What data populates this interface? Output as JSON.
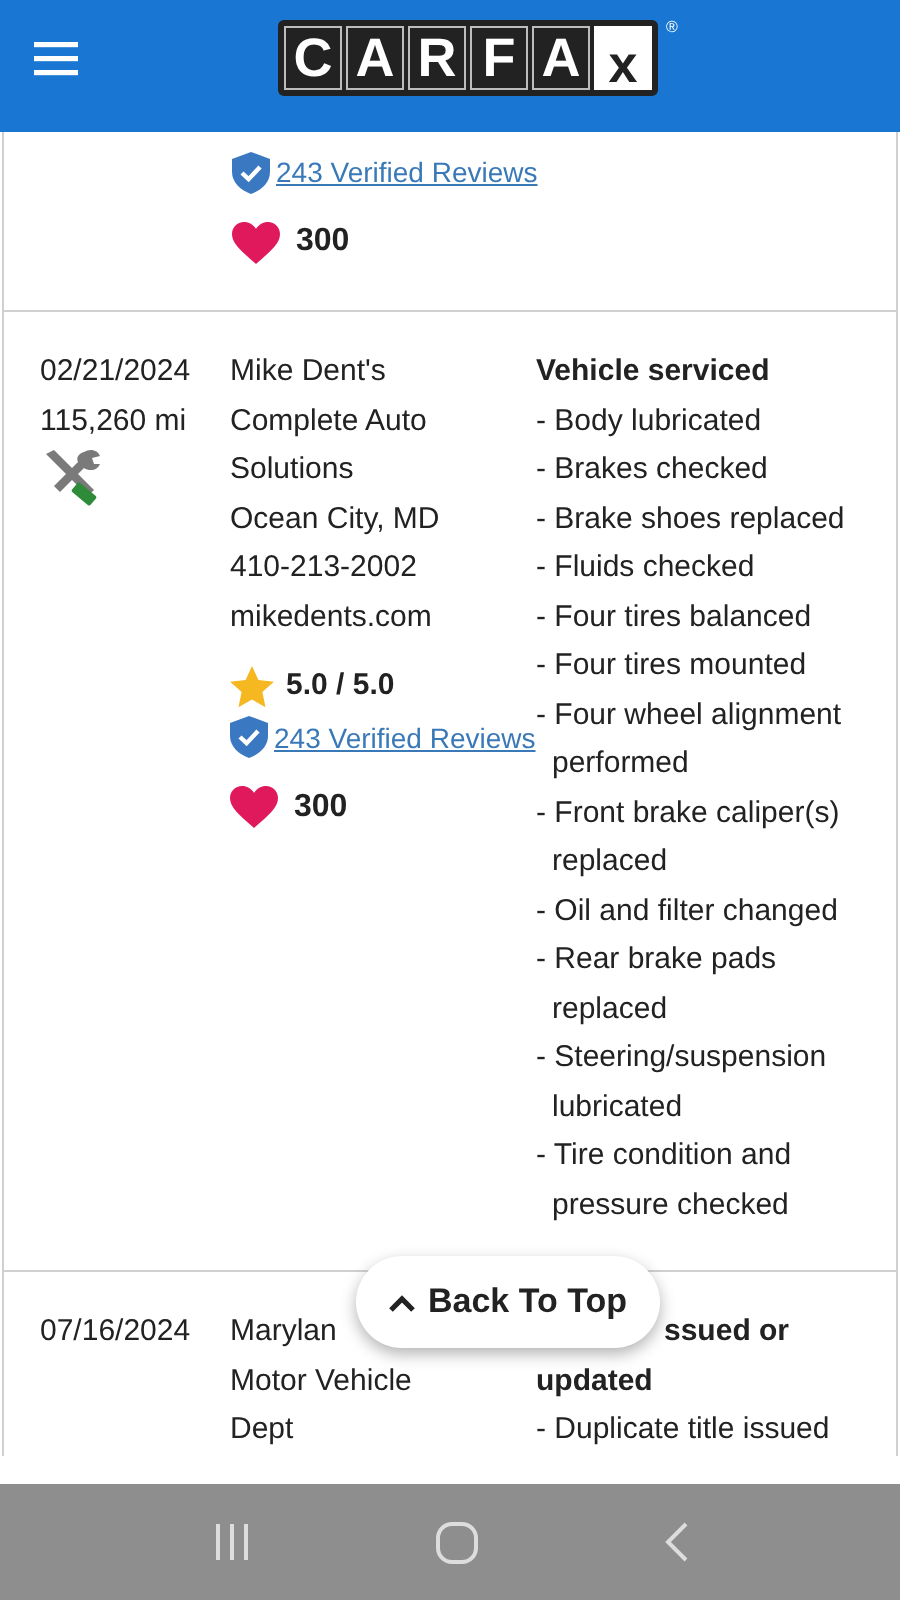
{
  "header": {
    "logo_letters": [
      "C",
      "A",
      "R",
      "F",
      "A",
      "x"
    ],
    "registered_mark": "®"
  },
  "records": [
    {
      "reviews_link": "243 Verified Reviews",
      "favorites": "300"
    },
    {
      "date": "02/21/2024",
      "mileage": "115,260 mi",
      "kind": "service",
      "source": [
        "Mike Dent's",
        "Complete Auto",
        "Solutions",
        "Ocean City, MD",
        "410-213-2002",
        "mikedents.com"
      ],
      "rating": "5.0 / 5.0",
      "reviews_link": "243 Verified Reviews",
      "favorites": "300",
      "heading": [
        "Vehicle serviced"
      ],
      "details": [
        "- Body lubricated",
        "- Brakes checked",
        "- Brake shoes replaced",
        "- Fluids checked",
        "- Four tires balanced",
        "- Four tires mounted",
        "- Four wheel alignment performed",
        "- Front brake caliper(s) replaced",
        "- Oil and filter changed",
        "- Rear brake pads replaced",
        "- Steering/suspension lubricated",
        "- Tire condition and pressure checked"
      ]
    },
    {
      "date": "07/16/2024",
      "source": [
        "Marylan",
        "Motor Vehicle",
        "Dept"
      ],
      "heading": [
        "ssued or",
        "updated"
      ],
      "details": [
        "- Duplicate title issued"
      ]
    }
  ],
  "back_to_top": {
    "label": "Back To Top"
  }
}
